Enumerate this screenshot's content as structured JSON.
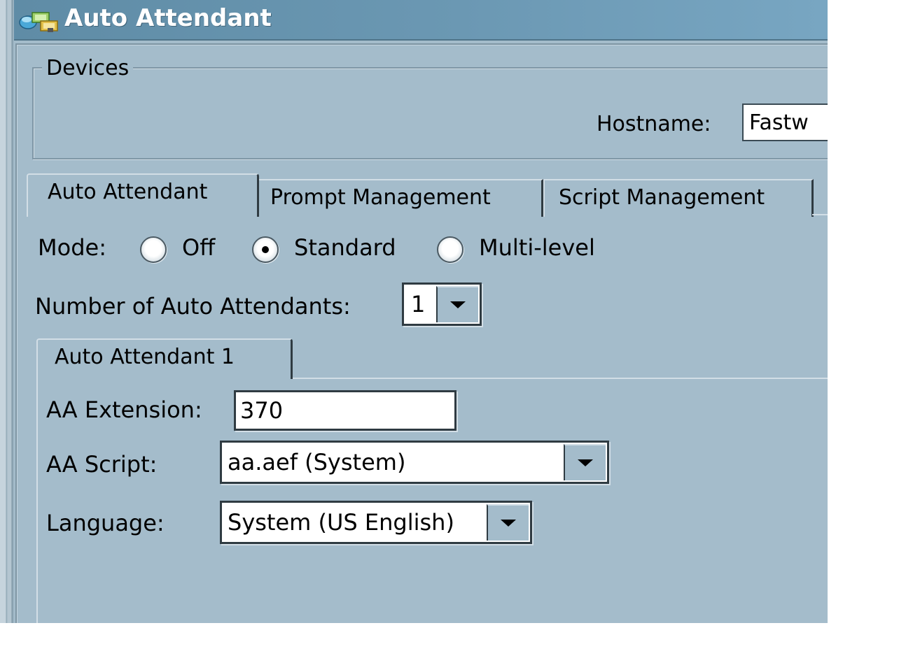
{
  "window": {
    "title": "Auto Attendant",
    "icon": "auto-attendant-app-icon"
  },
  "devices": {
    "legend": "Devices",
    "hostname_label": "Hostname:",
    "hostname_value": "Fastw"
  },
  "tabs": [
    {
      "label": "Auto Attendant",
      "selected": true
    },
    {
      "label": "Prompt Management",
      "selected": false
    },
    {
      "label": "Script Management",
      "selected": false
    }
  ],
  "mode": {
    "label": "Mode:",
    "options": [
      {
        "label": "Off",
        "checked": false
      },
      {
        "label": "Standard",
        "checked": true
      },
      {
        "label": "Multi-level",
        "checked": false
      }
    ]
  },
  "number_of_auto_attendants": {
    "label": "Number of Auto Attendants:",
    "value": "1"
  },
  "sub_tabs": [
    {
      "label": "Auto Attendant 1",
      "selected": true
    }
  ],
  "form": {
    "extension_label": "AA Extension:",
    "extension_value": "370",
    "script_label": "AA Script:",
    "script_value": "aa.aef (System)",
    "language_label": "Language:",
    "language_value": "System (US English)"
  },
  "colors": {
    "panel_background": "#a4bccb",
    "titlebar": "#6b98b3",
    "title_text": "#ffffff"
  }
}
